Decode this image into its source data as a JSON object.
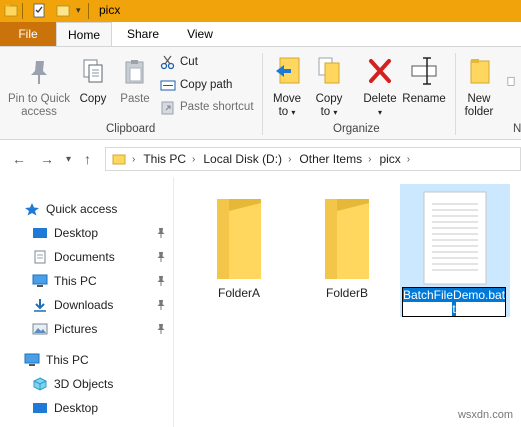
{
  "window": {
    "title": "picx"
  },
  "tabs": {
    "file": "File",
    "home": "Home",
    "share": "Share",
    "view": "View"
  },
  "ribbon": {
    "pin_to_quick_access": [
      "Pin to Quick",
      "access"
    ],
    "copy": "Copy",
    "paste": "Paste",
    "cut": "Cut",
    "copy_path": "Copy path",
    "paste_shortcut": "Paste shortcut",
    "clipboard_label": "Clipboard",
    "move_to": [
      "Move",
      "to"
    ],
    "copy_to": [
      "Copy",
      "to"
    ],
    "delete": "Delete",
    "rename": "Rename",
    "organize_label": "Organize",
    "new_folder": [
      "New",
      "folder"
    ],
    "new_label_partial": "N"
  },
  "address": {
    "crumbs": [
      "This PC",
      "Local Disk (D:)",
      "Other Items",
      "picx"
    ]
  },
  "nav": {
    "quick_access": "Quick access",
    "items": [
      "Desktop",
      "Documents",
      "This PC",
      "Downloads",
      "Pictures"
    ],
    "this_pc": "This PC",
    "pc_items": [
      "3D Objects",
      "Desktop"
    ]
  },
  "files": {
    "folder_a": "FolderA",
    "folder_b": "FolderB",
    "rename_line1": "BatchFileDemo.bat",
    "rename_line2": "t"
  },
  "watermark": "wsxdn.com",
  "colors": {
    "titlebar": "#f0a30a",
    "file_tab": "#c9730a",
    "selection": "#cce8ff",
    "accent": "#0078d7"
  }
}
